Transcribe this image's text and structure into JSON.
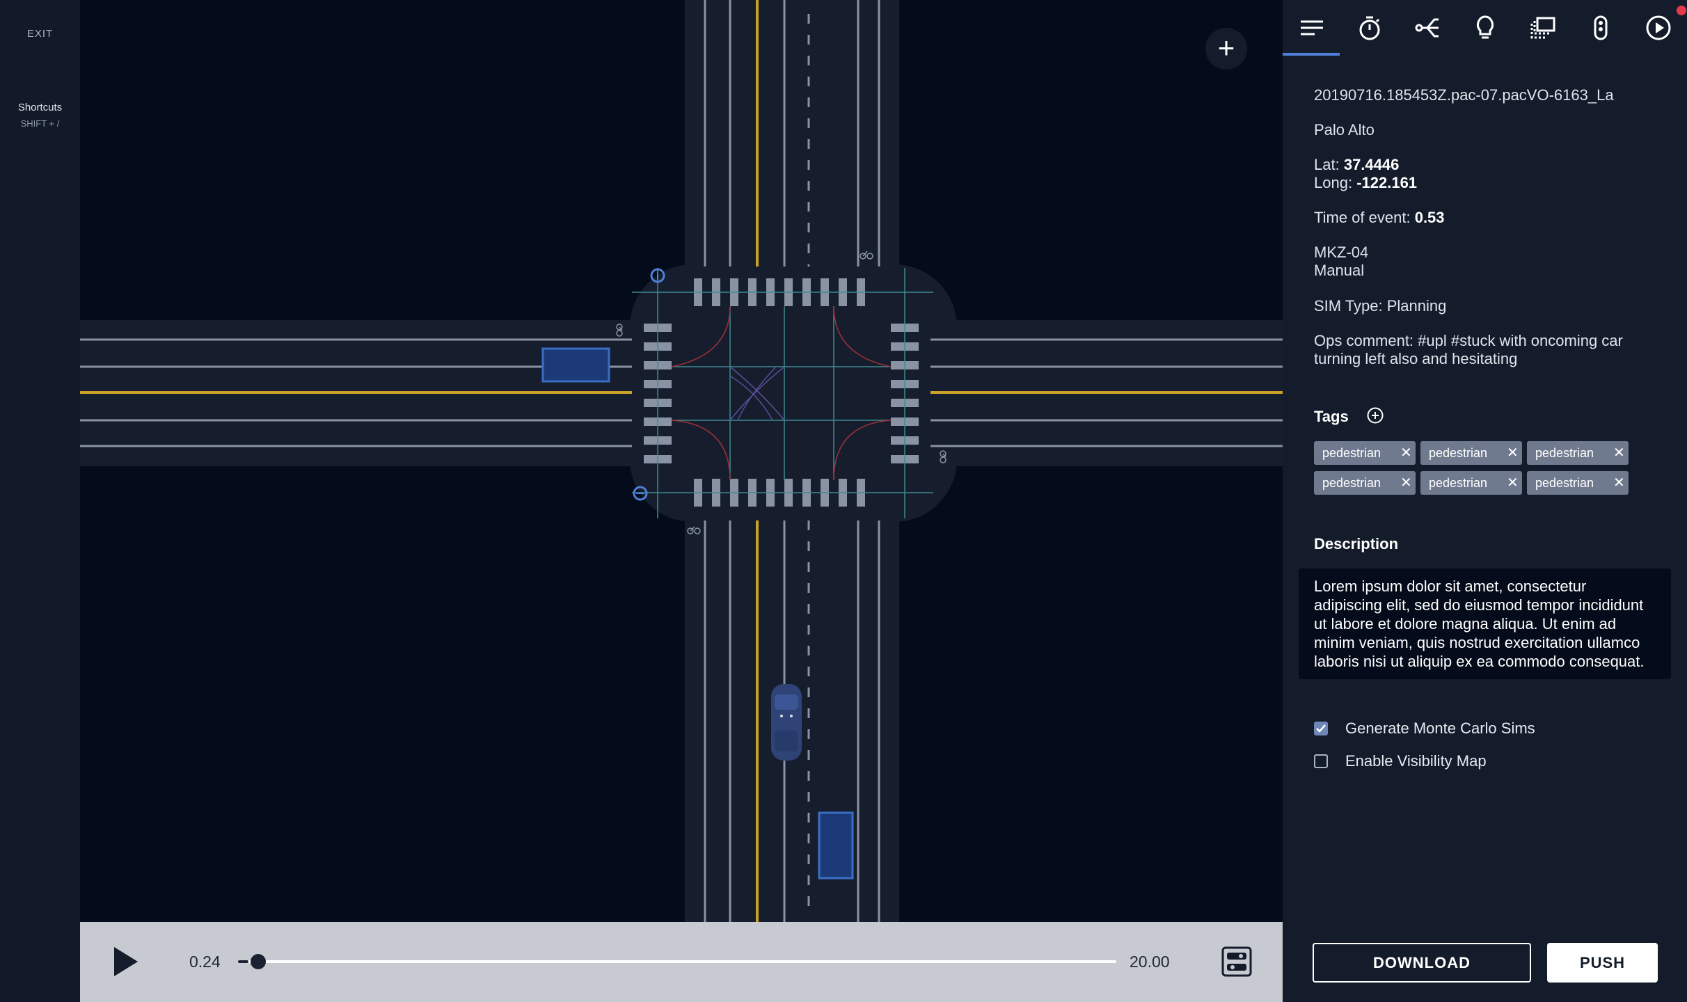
{
  "rail": {
    "exit_label": "EXIT",
    "shortcuts_label": "Shortcuts",
    "shortcuts_key": "SHIFT + /"
  },
  "map": {
    "add_label": "+"
  },
  "playback": {
    "current_time": "0.24",
    "end_time": "20.00",
    "progress": 0.012
  },
  "panel": {
    "tabs": [
      "list-icon",
      "stopwatch-icon",
      "branch-icon",
      "lightbulb-icon",
      "layers-icon",
      "traffic-light-icon",
      "play-circle-icon"
    ],
    "active_tab": 0,
    "log_id": "20190716.185453Z.pac-07.pacVO-6163_La",
    "location": "Palo Alto",
    "lat_label": "Lat:",
    "lat_value": "37.4446",
    "long_label": "Long:",
    "long_value": "-122.161",
    "event_label": "Time of event:",
    "event_value": "0.53",
    "vehicle": "MKZ-04",
    "mode": "Manual",
    "sim_type": "SIM Type: Planning",
    "ops_comment_line1": "Ops comment: #upl #stuck with oncoming car",
    "ops_comment_line2": "turning left also and hesitating",
    "tags_title": "Tags",
    "tags": [
      "pedestrian",
      "pedestrian",
      "pedestrian",
      "pedestrian",
      "pedestrian",
      "pedestrian"
    ],
    "description_title": "Description",
    "description": "Lorem ipsum dolor sit amet, consectetur adipiscing elit, sed do eiusmod tempor incididunt ut labore et dolore magna aliqua. Ut enim ad minim veniam, quis nostrud exercitation ullamco laboris nisi ut aliquip ex ea commodo consequat.",
    "options": [
      {
        "label": "Generate Monte Carlo Sims",
        "checked": true
      },
      {
        "label": "Enable Visibility Map",
        "checked": false
      }
    ],
    "download_label": "DOWNLOAD",
    "push_label": "PUSH"
  },
  "colors": {
    "background": "#040b1a",
    "panel": "#141c2b",
    "accent": "#4f7fd8",
    "road": "#161e2e",
    "lane_yellow": "#c9a227",
    "tag": "#6f7a8e"
  }
}
